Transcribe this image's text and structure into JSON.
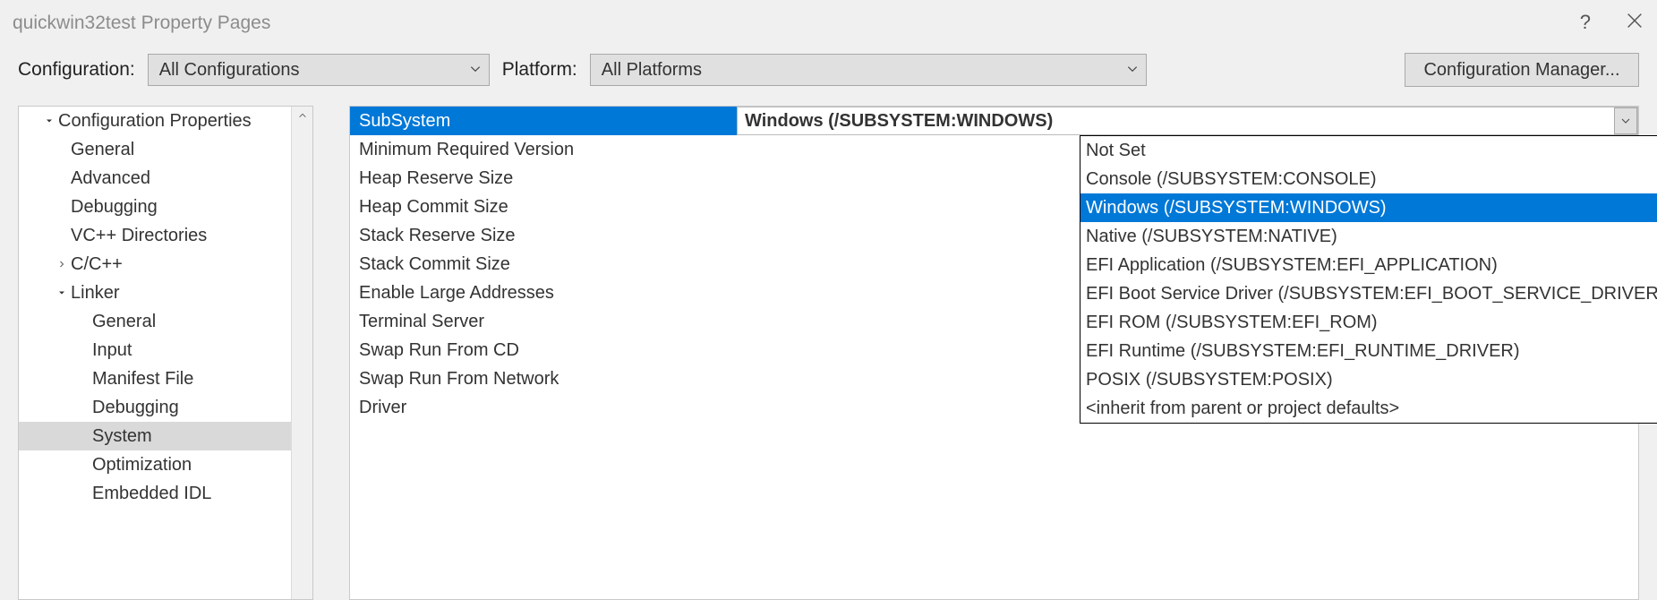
{
  "window": {
    "title": "quickwin32test Property Pages"
  },
  "toolbar": {
    "config_label": "Configuration:",
    "config_value": "All Configurations",
    "platform_label": "Platform:",
    "platform_value": "All Platforms",
    "mgr_button": "Configuration Manager..."
  },
  "tree": [
    {
      "label": "Configuration Properties",
      "depth": 1,
      "arrow": "down"
    },
    {
      "label": "General",
      "depth": 2
    },
    {
      "label": "Advanced",
      "depth": 2
    },
    {
      "label": "Debugging",
      "depth": 2
    },
    {
      "label": "VC++ Directories",
      "depth": 2
    },
    {
      "label": "C/C++",
      "depth": 2,
      "arrow": "right"
    },
    {
      "label": "Linker",
      "depth": 2,
      "arrow": "down"
    },
    {
      "label": "General",
      "depth": 3
    },
    {
      "label": "Input",
      "depth": 3
    },
    {
      "label": "Manifest File",
      "depth": 3
    },
    {
      "label": "Debugging",
      "depth": 3
    },
    {
      "label": "System",
      "depth": 3,
      "selected": true
    },
    {
      "label": "Optimization",
      "depth": 3
    },
    {
      "label": "Embedded IDL",
      "depth": 3
    }
  ],
  "grid": [
    {
      "name": "SubSystem",
      "value": "Windows (/SUBSYSTEM:WINDOWS)",
      "selected": true
    },
    {
      "name": "Minimum Required Version",
      "value": ""
    },
    {
      "name": "Heap Reserve Size",
      "value": ""
    },
    {
      "name": "Heap Commit Size",
      "value": ""
    },
    {
      "name": "Stack Reserve Size",
      "value": ""
    },
    {
      "name": "Stack Commit Size",
      "value": ""
    },
    {
      "name": "Enable Large Addresses",
      "value": ""
    },
    {
      "name": "Terminal Server",
      "value": ""
    },
    {
      "name": "Swap Run From CD",
      "value": ""
    },
    {
      "name": "Swap Run From Network",
      "value": ""
    },
    {
      "name": "Driver",
      "value": ""
    }
  ],
  "dropdown": {
    "highlighted": "Windows (/SUBSYSTEM:WINDOWS)",
    "options": [
      "Not Set",
      "Console (/SUBSYSTEM:CONSOLE)",
      "Windows (/SUBSYSTEM:WINDOWS)",
      "Native (/SUBSYSTEM:NATIVE)",
      "EFI Application (/SUBSYSTEM:EFI_APPLICATION)",
      "EFI Boot Service Driver (/SUBSYSTEM:EFI_BOOT_SERVICE_DRIVER)",
      "EFI ROM (/SUBSYSTEM:EFI_ROM)",
      "EFI Runtime (/SUBSYSTEM:EFI_RUNTIME_DRIVER)",
      "POSIX (/SUBSYSTEM:POSIX)",
      "<inherit from parent or project defaults>"
    ]
  }
}
